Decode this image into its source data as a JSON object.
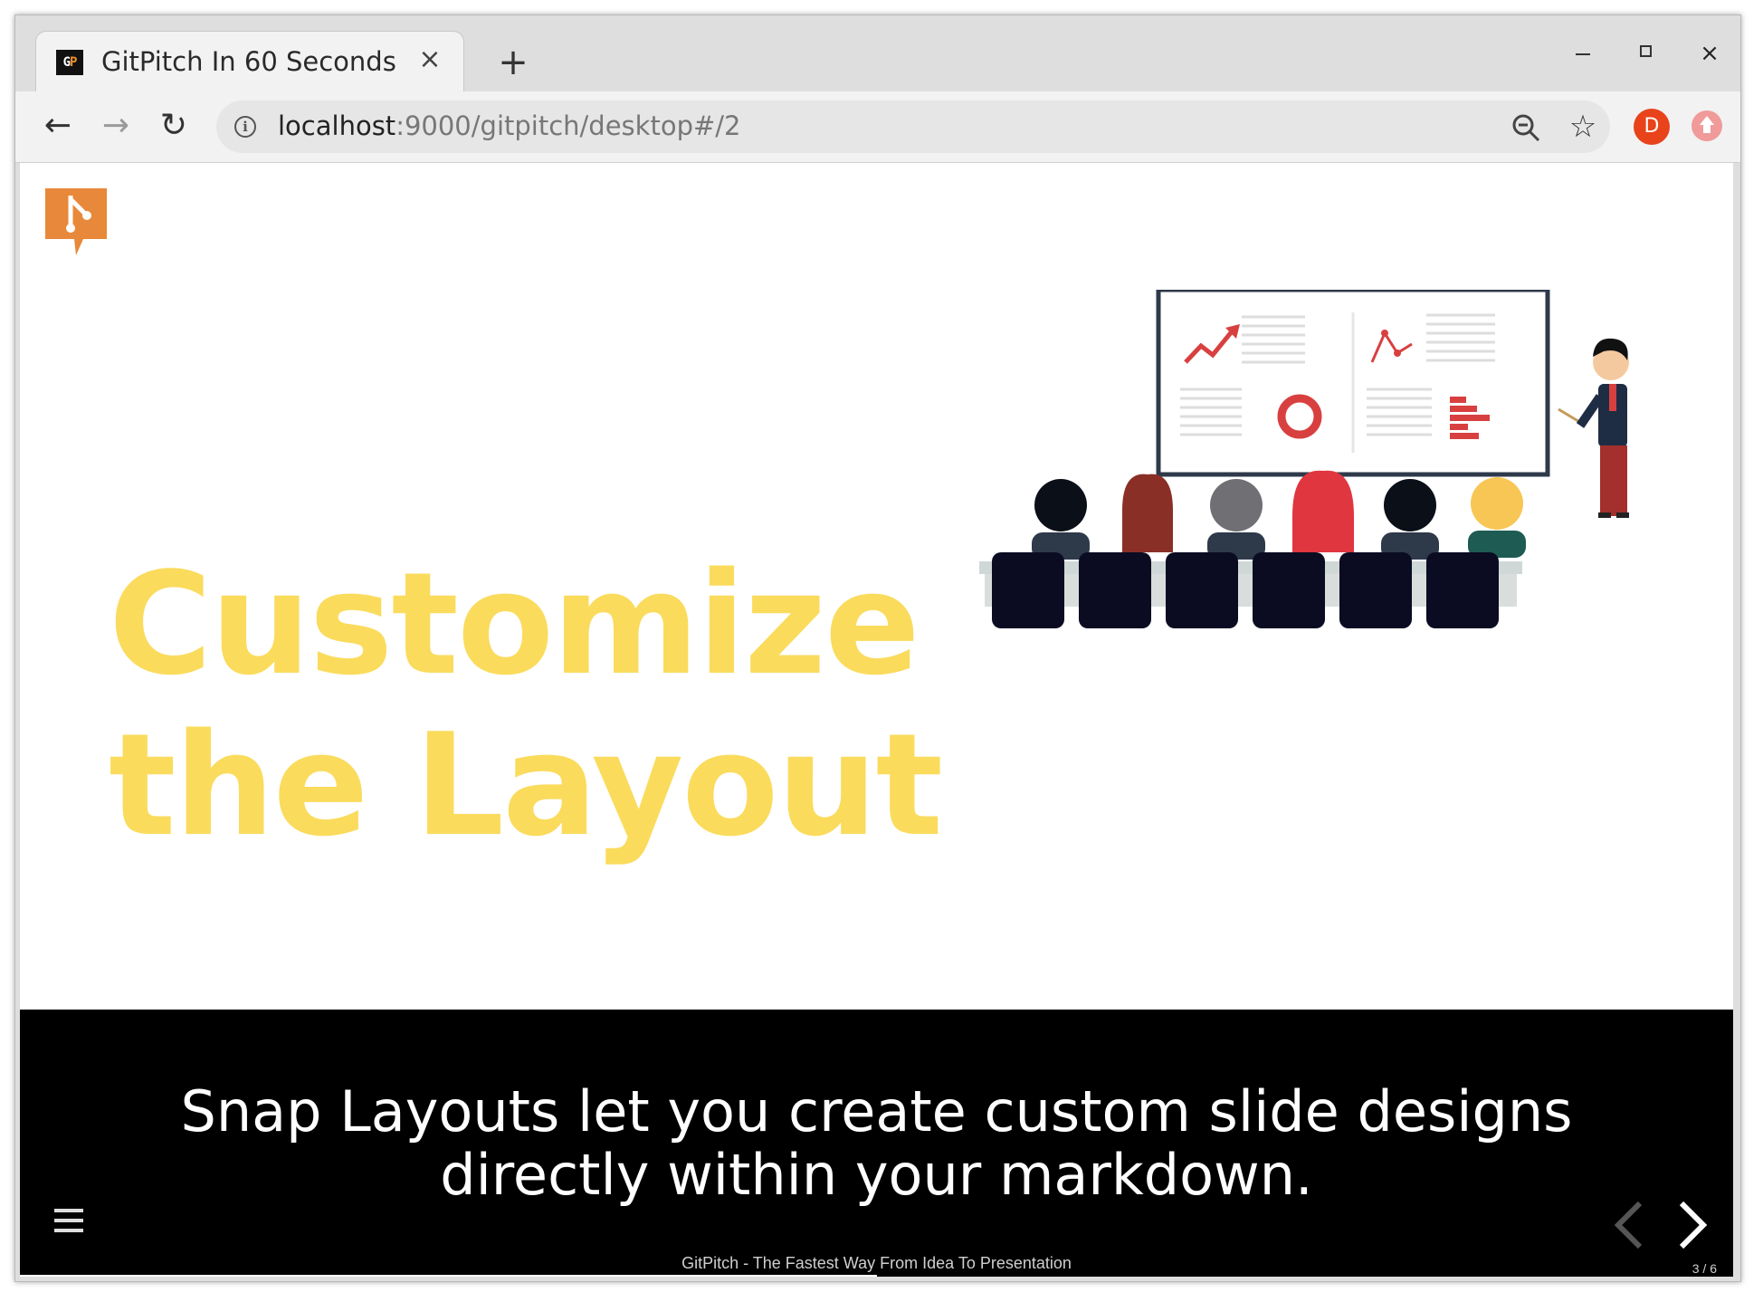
{
  "browser": {
    "tab": {
      "favicon_text": "GP",
      "title": "GitPitch In 60 Seconds",
      "close": "×"
    },
    "new_tab": "+",
    "window_controls": {
      "close": "×"
    },
    "nav": {
      "back": "←",
      "forward": "→",
      "reload": "↻"
    },
    "address": {
      "host": "localhost",
      "path": ":9000/gitpitch/desktop#/2"
    },
    "star": "☆",
    "profile_initial": "D"
  },
  "slide": {
    "headline_line1": "Customize",
    "headline_line2": "the Layout",
    "caption_line1": "Snap Layouts let you create custom slide designs",
    "caption_line2": "directly within your markdown.",
    "footer": "GitPitch - The Fastest Way From Idea To Presentation",
    "slide_number": "3 / 6",
    "progress": 0.5,
    "colors": {
      "headline": "#fadb5c",
      "logo": "#e8883a",
      "bar": "#000000"
    }
  },
  "icons": {
    "logo": "gitpitch-logo-icon",
    "menu": "hamburger-menu-icon",
    "prev": "chevron-left-icon",
    "next": "chevron-right-icon",
    "zoom": "zoom-out-icon",
    "info": "info-icon",
    "illustration": "presentation-audience-illustration"
  }
}
